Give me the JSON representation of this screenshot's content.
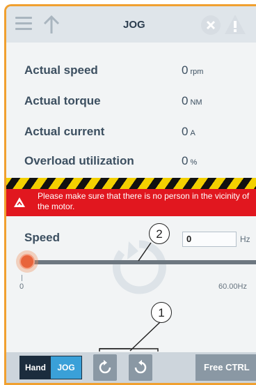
{
  "header": {
    "title": "JOG",
    "icons": [
      "menu-icon",
      "arrow-up-icon",
      "fault-icon",
      "warning-icon"
    ]
  },
  "stats": [
    {
      "label": "Actual speed",
      "value": "0",
      "unit": "rpm"
    },
    {
      "label": "Actual torque",
      "value": "0",
      "unit": "NM"
    },
    {
      "label": "Actual current",
      "value": "0",
      "unit": "A"
    },
    {
      "label": "Overload utilization",
      "value": "0",
      "unit": "%"
    }
  ],
  "alert": {
    "text": "Please make sure that there is no person in the vicinity of the motor.",
    "color": "#e1171f"
  },
  "speed": {
    "label": "Speed",
    "input_value": "0",
    "unit": "Hz",
    "min_label": "0",
    "max_label": "60.00Hz",
    "slider_fraction": 0
  },
  "callouts": {
    "one": "1",
    "two": "2"
  },
  "toolbar": {
    "hand_label": "Hand",
    "jog_label": "JOG",
    "free_ctrl_label": "Free CTRL",
    "rotate_cw_icon": "rotate-clockwise-icon",
    "rotate_ccw_icon": "rotate-counterclockwise-icon"
  },
  "colors": {
    "accent_border": "#f0a030",
    "jog_active": "#3aa0d8",
    "slider_thumb": "#e8643b"
  }
}
